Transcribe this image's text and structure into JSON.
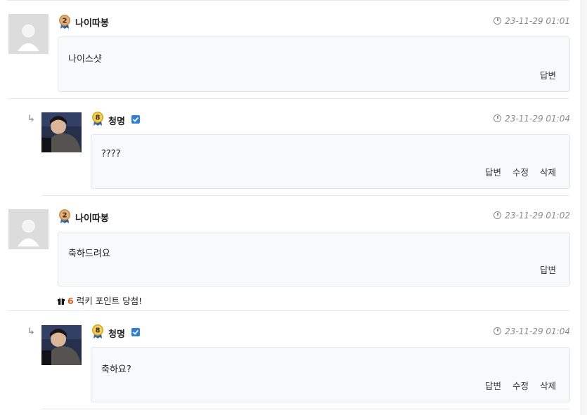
{
  "comments": [
    {
      "author": "나이따봉",
      "level": "2",
      "time": "23-11-29 01:01",
      "body": "나이스샷",
      "actions": [
        "답변"
      ]
    },
    {
      "author": "청명",
      "level": "8",
      "time": "23-11-29 01:04",
      "body": "????",
      "actions": [
        "답변",
        "수정",
        "삭제"
      ]
    },
    {
      "author": "나이따봉",
      "level": "2",
      "time": "23-11-29 01:02",
      "body": "축하드려요",
      "actions": [
        "답변"
      ],
      "lucky": {
        "points": "6",
        "text": "럭키 포인트 당첨!"
      }
    },
    {
      "author": "청명",
      "level": "8",
      "time": "23-11-29 01:04",
      "body": "축하요?",
      "actions": [
        "답변",
        "수정",
        "삭제"
      ]
    }
  ],
  "colors": {
    "accent_check": "#2f7fd4",
    "lucky_number": "#e05a1a",
    "box_bg": "#f8f9fb"
  },
  "icons": [
    "clock-icon",
    "reply-arrow-icon",
    "verified-check-icon",
    "level-badge-icon",
    "gift-icon",
    "default-avatar-icon"
  ]
}
